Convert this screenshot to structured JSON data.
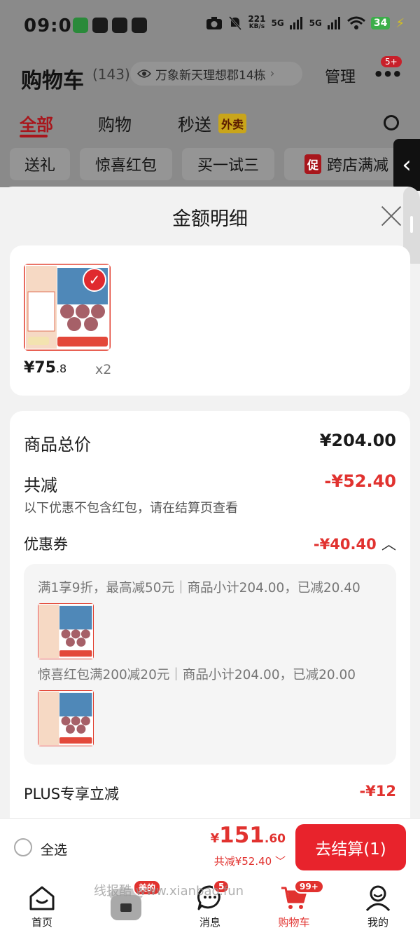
{
  "status_bar": {
    "time": "09:09",
    "net_speed": "221",
    "net_unit": "KB/s",
    "sig1": "5G",
    "sig2": "5G",
    "battery": "34"
  },
  "cart_header": {
    "title": "购物车",
    "count": "(143)",
    "address": "万象新天理想郡14栋",
    "manage_label": "管理",
    "more_badge": "5+"
  },
  "tabs": {
    "all": "全部",
    "shopping": "购物",
    "flash": "秒送",
    "takeout_tag": "外卖"
  },
  "filter_chips": {
    "gift": "送礼",
    "surprise": "惊喜红包",
    "try": "买一试三",
    "promo_tag": "促",
    "cross_store": "跨店满减"
  },
  "sheet": {
    "title": "金额明细",
    "product": {
      "price_int": "¥75",
      "price_dec": ".8",
      "qty": "x2"
    },
    "total_label": "商品总价",
    "total_value": "¥204.00",
    "discount_label": "共减",
    "discount_value": "-¥52.40",
    "discount_note": "以下优惠不包含红包，请在结算页查看",
    "coupon_label": "优惠券",
    "coupon_value": "-¥40.40",
    "coupon_lines": [
      "满1享9折，最高减50元｜商品小计204.00，已减20.40",
      "惊喜红包满200减20元｜商品小计204.00，已减20.00"
    ],
    "plus_label": "PLUS专享立减",
    "plus_value": "-¥12"
  },
  "checkout": {
    "select_all": "全选",
    "currency": "¥",
    "total_int": "151",
    "total_dec": ".60",
    "saved": "共减¥52.40",
    "pay_label": "去结算(1)"
  },
  "bottom_nav": {
    "home": "首页",
    "meide_badge": "美的",
    "messages": "消息",
    "messages_badge": "5",
    "cart": "购物车",
    "cart_badge": "99+",
    "mine": "我的"
  },
  "watermark": "线报酷 www.xianbao.fun",
  "colors": {
    "accent_red": "#e1322f",
    "pay_button": "#e8232c",
    "dim_overlay": "#8a8a8a"
  },
  "icons": [
    "camera-icon",
    "mute-icon",
    "wifi-icon",
    "eye-icon",
    "close-icon",
    "check-icon",
    "home-icon",
    "message-icon",
    "cart-icon",
    "user-icon",
    "chevron-left-icon"
  ]
}
